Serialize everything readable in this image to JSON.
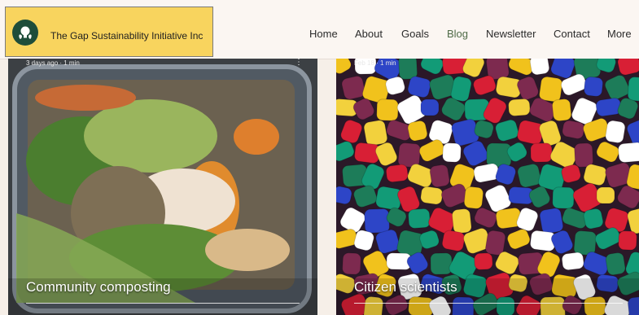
{
  "brand": {
    "name": "The Gap Sustainability Initiative Inc",
    "logo_icon": "lightbulb-leaf-icon"
  },
  "nav": {
    "items": [
      "Home",
      "About",
      "Goals",
      "Blog",
      "Newsletter",
      "Contact",
      "More"
    ],
    "active": "Blog"
  },
  "posts": [
    {
      "meta": "3 days ago · 1 min",
      "title": "Community composting"
    },
    {
      "meta": "Feb 18 · 1 min",
      "title": "Citizen scientists"
    }
  ],
  "colors": {
    "brand_bg": "#f8d45e",
    "logo_bg": "#1e4d3a",
    "nav_active": "#4f6b47",
    "page_bg": "#f6efe8"
  }
}
